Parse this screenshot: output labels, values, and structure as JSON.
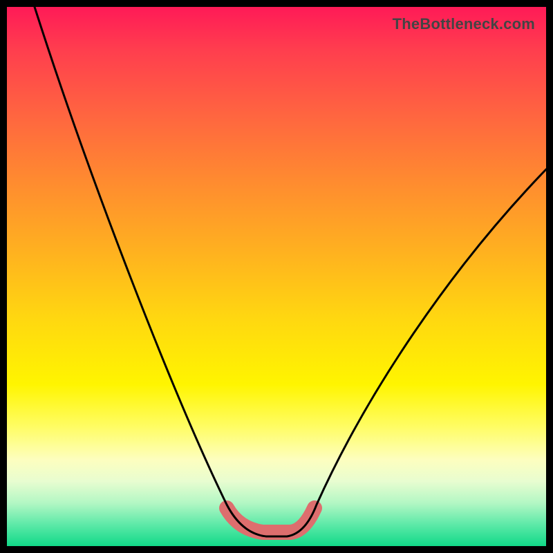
{
  "watermark": "TheBottleneck.com",
  "chart_data": {
    "type": "line",
    "title": "",
    "xlabel": "",
    "ylabel": "",
    "xlim": [
      0,
      100
    ],
    "ylim": [
      0,
      100
    ],
    "background_gradient": {
      "top_color": "#ff1a57",
      "bottom_color": "#11d988",
      "note": "Red (high bottleneck) at top, green (no bottleneck) at bottom"
    },
    "series": [
      {
        "name": "bottleneck-curve",
        "note": "V-shaped curve; y is bottleneck % where 0 = bottom (green), 100 = top (red). x is relative hardware balance.",
        "x": [
          5,
          10,
          15,
          20,
          25,
          30,
          35,
          40,
          43,
          47,
          51,
          55,
          57,
          62,
          70,
          80,
          90,
          100
        ],
        "y": [
          100,
          88,
          76,
          64,
          52,
          40,
          28,
          15,
          6,
          2,
          2,
          2,
          6,
          15,
          28,
          44,
          58,
          70
        ]
      },
      {
        "name": "optimal-zone-marker",
        "note": "Highlighted segment near the valley floor (shown as thick pink marker).",
        "x": [
          41,
          45,
          50,
          54,
          57
        ],
        "y": [
          7,
          3,
          2,
          3,
          7
        ],
        "style": {
          "stroke": "#dd6e6e",
          "stroke_width": 22,
          "linecap": "round"
        }
      }
    ]
  }
}
